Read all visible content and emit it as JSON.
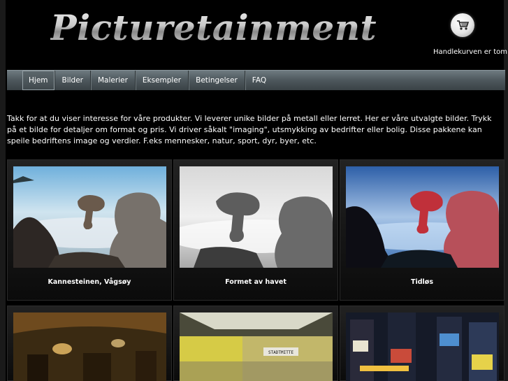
{
  "header": {
    "logo_text": "Picturetainment",
    "cart_icon": "shopping-cart-icon",
    "cart_status": "Handlekurven er tom"
  },
  "nav": {
    "items": [
      {
        "label": "Hjem",
        "active": true
      },
      {
        "label": "Bilder"
      },
      {
        "label": "Malerier"
      },
      {
        "label": "Eksempler"
      },
      {
        "label": "Betingelser"
      },
      {
        "label": "FAQ"
      }
    ]
  },
  "intro": "Takk for at du viser interesse for våre produkter. Vi leverer unike bilder på metall eller lerret. Her er våre utvalgte bilder. Trykk på et bilde for detaljer om format og pris. Vi driver såkalt \"imaging\", utsmykking av bedrifter eller bolig. Disse pakkene kan speile bedriftens image og verdier. F.eks mennesker, natur, sport, dyr, byer, etc.",
  "gallery": [
    {
      "caption": "Kannesteinen, Vågsøy"
    },
    {
      "caption": "Formet av havet"
    },
    {
      "caption": "Tidløs"
    },
    {
      "caption": ""
    },
    {
      "caption": "",
      "sign": "STADTMITTE"
    },
    {
      "caption": ""
    }
  ],
  "colors": {
    "background": "#000000",
    "navbar": "#4d575c"
  }
}
